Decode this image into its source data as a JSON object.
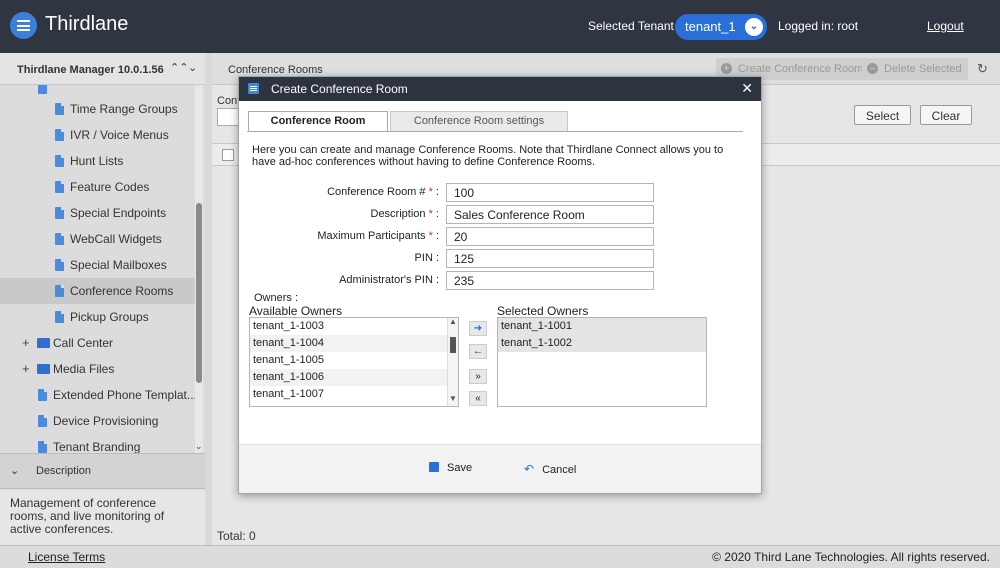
{
  "header": {
    "app_title": "Thirdlane",
    "tenant_label": "Selected Tenant :",
    "tenant_value": "tenant_1",
    "logged_in": "Logged in: root",
    "logout": "Logout"
  },
  "left": {
    "title": "Thirdlane Manager 10.0.1.56",
    "items": [
      {
        "label": "Time Range Groups",
        "kind": "doc"
      },
      {
        "label": "IVR / Voice Menus",
        "kind": "doc"
      },
      {
        "label": "Hunt Lists",
        "kind": "doc"
      },
      {
        "label": "Feature Codes",
        "kind": "doc"
      },
      {
        "label": "Special Endpoints",
        "kind": "doc"
      },
      {
        "label": "WebCall Widgets",
        "kind": "doc"
      },
      {
        "label": "Special Mailboxes",
        "kind": "doc"
      },
      {
        "label": "Conference Rooms",
        "kind": "doc"
      },
      {
        "label": "Pickup Groups",
        "kind": "doc"
      },
      {
        "label": "Call Center",
        "kind": "folder"
      },
      {
        "label": "Media Files",
        "kind": "folder"
      },
      {
        "label": "Extended Phone Templat...",
        "kind": "doc"
      },
      {
        "label": "Device Provisioning",
        "kind": "doc"
      },
      {
        "label": "Tenant Branding",
        "kind": "doc"
      }
    ],
    "description_title": "Description",
    "description_text": "Management of conference rooms, and live monitoring of active conferences."
  },
  "main": {
    "breadcrumb": "Conference Rooms",
    "create_label": "Create Conference Room",
    "delete_label": "Delete Selected",
    "filter_label": "Conf",
    "select_label": "Select",
    "clear_label": "Clear",
    "total": "Total: 0"
  },
  "status": {
    "license": "License Terms",
    "copyright": "© 2020 Third Lane Technologies. All rights reserved."
  },
  "modal": {
    "title": "Create Conference Room",
    "tab_main": "Conference Room",
    "tab_settings": "Conference Room settings",
    "intro": "Here you can create and manage Conference Rooms. Note that Thirdlane Connect allows you to have ad-hoc conferences without having to define Conference Rooms.",
    "fields": {
      "room_number": {
        "label": "Conference Room #",
        "value": "100"
      },
      "description": {
        "label": "Description",
        "value": "Sales Conference Room"
      },
      "max_participants": {
        "label": "Maximum Participants",
        "value": "20"
      },
      "pin": {
        "label": "PIN :",
        "value": "125"
      },
      "admin_pin": {
        "label": "Administrator's PIN :",
        "value": "235"
      }
    },
    "owners_label": "Owners :",
    "available_title": "Available Owners",
    "selected_title": "Selected Owners",
    "available": [
      "tenant_1-1003",
      "tenant_1-1004",
      "tenant_1-1005",
      "tenant_1-1006",
      "tenant_1-1007"
    ],
    "selected": [
      "tenant_1-1001",
      "tenant_1-1002"
    ],
    "save_label": "Save",
    "cancel_label": "Cancel"
  }
}
